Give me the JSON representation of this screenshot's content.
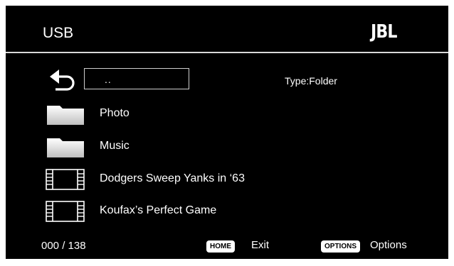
{
  "header": {
    "title": "USB",
    "logo_text": "JBL"
  },
  "path": {
    "current": "..",
    "type_label": "Type:Folder"
  },
  "files": [
    {
      "name": "Photo",
      "icon": "folder-icon"
    },
    {
      "name": "Music",
      "icon": "folder-icon"
    },
    {
      "name": "Dodgers Sweep Yanks in ‘63",
      "icon": "film-icon"
    },
    {
      "name": "Koufax’s Perfect Game",
      "icon": "film-icon"
    }
  ],
  "footer": {
    "count": "000 / 138",
    "home_key": "HOME",
    "home_action": "Exit",
    "options_key": "OPTIONS",
    "options_action": "Options"
  },
  "colors": {
    "background": "#000000",
    "text": "#ffffff",
    "divider": "#d8d8d8",
    "frame": "#ffffff"
  }
}
